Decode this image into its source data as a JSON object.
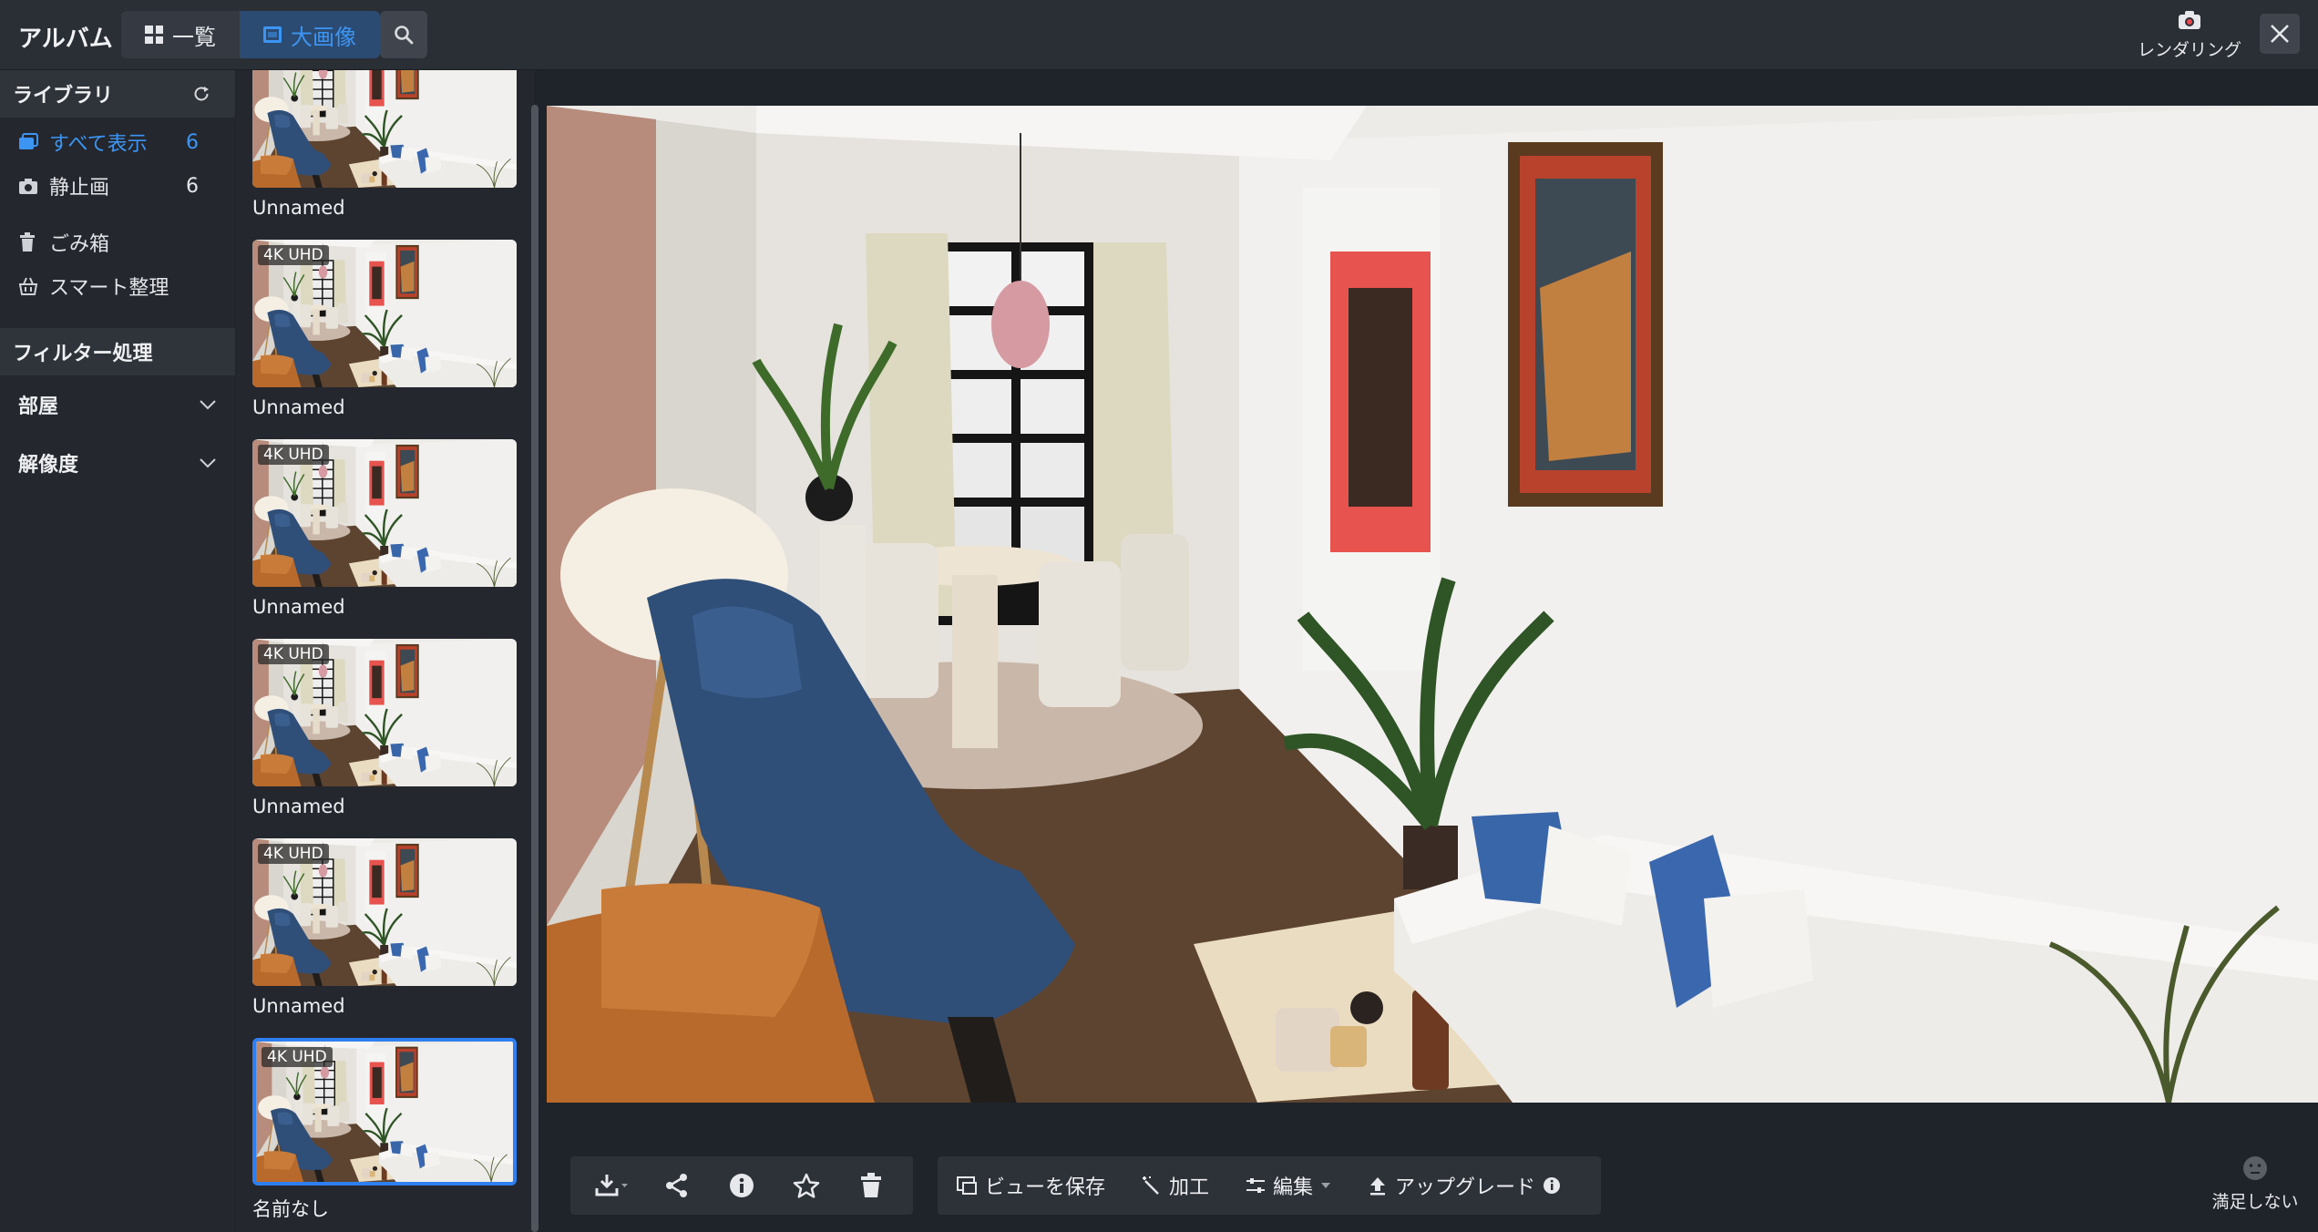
{
  "app": {
    "title": "アルバム"
  },
  "view_modes": [
    {
      "label": "一覧",
      "icon": "grid-icon",
      "active": false
    },
    {
      "label": "大画像",
      "icon": "image-icon",
      "active": true
    }
  ],
  "header": {
    "render_label": "レンダリング"
  },
  "sidebar": {
    "library_title": "ライブラリ",
    "items": [
      {
        "label": "すべて表示",
        "count": "6",
        "icon": "gallery-icon",
        "active": true
      },
      {
        "label": "静止画",
        "count": "6",
        "icon": "camera-icon",
        "active": false
      }
    ],
    "items2": [
      {
        "label": "ごみ箱",
        "icon": "trash-icon"
      },
      {
        "label": "スマート整理",
        "icon": "basket-icon"
      }
    ],
    "filter_title": "フィルター処理",
    "filters": [
      {
        "label": "部屋"
      },
      {
        "label": "解像度"
      }
    ]
  },
  "thumbnails": [
    {
      "name": "Unnamed",
      "badge": ""
    },
    {
      "name": "Unnamed",
      "badge": "4K UHD"
    },
    {
      "name": "Unnamed",
      "badge": "4K UHD"
    },
    {
      "name": "Unnamed",
      "badge": "4K UHD"
    },
    {
      "name": "Unnamed",
      "badge": "4K UHD"
    },
    {
      "name": "名前なし",
      "badge": "4K UHD",
      "selected": true
    }
  ],
  "toolbar": {
    "icons": [
      "download-icon",
      "share-icon",
      "info-icon",
      "star-icon",
      "trash-icon"
    ],
    "save_view": "ビューを保存",
    "process": "加工",
    "edit": "編集",
    "upgrade": "アップグレード"
  },
  "feedback": {
    "label": "満足しない"
  },
  "colors": {
    "accent": "#3d95f3",
    "topbar": "#2a2e35",
    "panel": "#24282e"
  }
}
